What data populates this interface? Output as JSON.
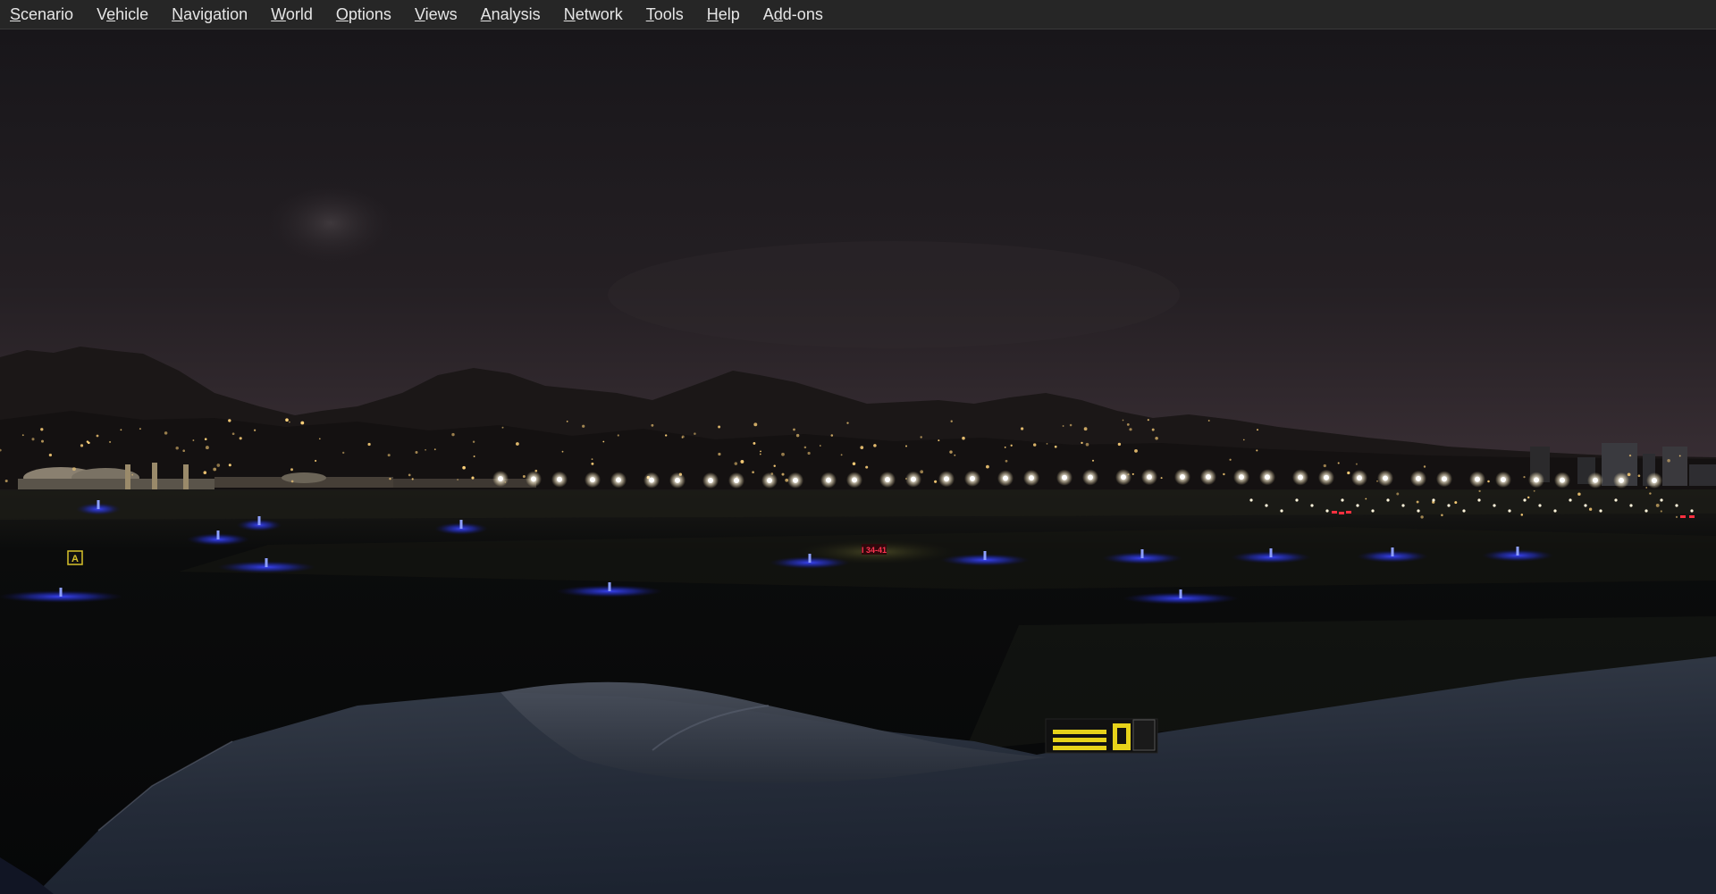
{
  "menubar": {
    "items": [
      {
        "label": "Scenario",
        "mnemonic": "S",
        "rest": "cenario"
      },
      {
        "label": "Vehicle",
        "mnemonic": "V",
        "pre": "",
        "rest": "ehicle",
        "mnemonic_index": 1
      },
      {
        "label": "Navigation",
        "mnemonic": "N",
        "rest": "avigation"
      },
      {
        "label": "World",
        "mnemonic": "W",
        "rest": "orld"
      },
      {
        "label": "Options",
        "mnemonic": "O",
        "rest": "ptions"
      },
      {
        "label": "Views",
        "mnemonic": "V",
        "rest": "iews"
      },
      {
        "label": "Analysis",
        "mnemonic": "A",
        "rest": "nalysis"
      },
      {
        "label": "Network",
        "mnemonic": "N",
        "rest": "etwork"
      },
      {
        "label": "Tools",
        "mnemonic": "T",
        "rest": "ools"
      },
      {
        "label": "Help",
        "mnemonic": "H",
        "rest": "elp"
      },
      {
        "label": "Add-ons",
        "mnemonic": "d",
        "rest": "d-ons"
      }
    ]
  },
  "scene": {
    "taxiway_sign_left": "A",
    "sign_red_center": "I 34-41",
    "colors": {
      "sky_top": "#1b181a",
      "sky_horizon": "#3a3036",
      "mountains": "#1a1616",
      "ground": "#0a0b0c",
      "taxi_light_blue": "#2a35ff",
      "runway_light": "#ffffff",
      "city_light": "#ffd27a",
      "wing": "#2a3140",
      "sign_yellow": "#e6d21a",
      "sign_red": "#ff2a4a"
    }
  }
}
